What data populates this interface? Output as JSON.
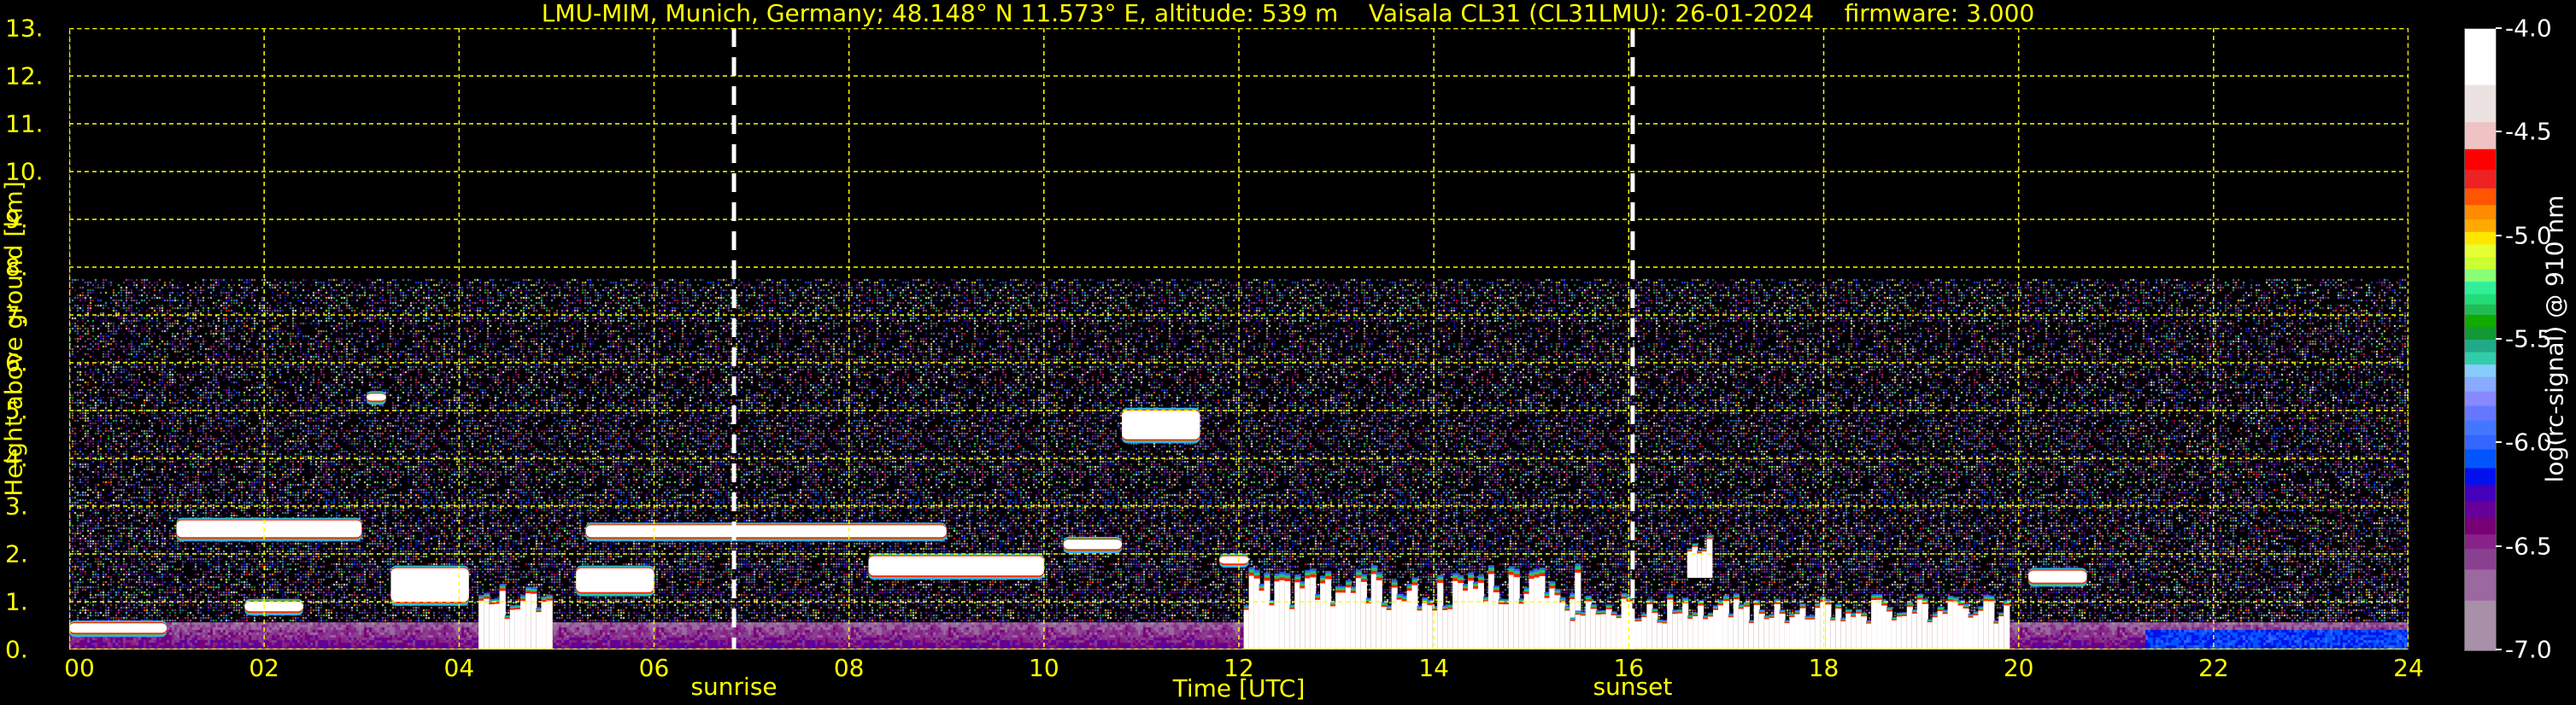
{
  "chart_data": {
    "type": "heatmap",
    "title": "LMU-MIM, Munich, Germany; 48.148° N 11.573° E, altitude: 539 m    Vaisala CL31 (CL31LMU): 26-01-2024    firmware: 3.000",
    "xlabel": "Time [UTC]",
    "ylabel": "Height above ground [km]",
    "xlim": [
      0,
      24
    ],
    "ylim": [
      0,
      13
    ],
    "x_ticks": [
      0,
      2,
      4,
      6,
      8,
      10,
      12,
      14,
      16,
      18,
      20,
      22,
      24
    ],
    "x_tick_labels": [
      "00",
      "02",
      "04",
      "06",
      "08",
      "10",
      "12",
      "14",
      "16",
      "18",
      "20",
      "22",
      "24"
    ],
    "y_ticks": [
      0,
      1,
      2,
      3,
      4,
      5,
      6,
      7,
      8,
      9,
      10,
      11,
      12,
      13
    ],
    "y_tick_labels": [
      "0.",
      "1.",
      "2.",
      "3.",
      "4.",
      "5.",
      "6.",
      "7.",
      "8.",
      "9.",
      "10.",
      "11.",
      "12.",
      "13."
    ],
    "grid": true,
    "events": [
      {
        "label": "sunrise",
        "time": 6.82
      },
      {
        "label": "sunset",
        "time": 16.04
      }
    ],
    "signal_max_height_km": 7.75,
    "colorbar": {
      "label": "log(rc-signal) @ 910 nm",
      "range": [
        -7.0,
        -4.0
      ],
      "tick_values": [
        -4.0,
        -4.5,
        -5.0,
        -5.5,
        -6.0,
        -6.5,
        -7.0
      ],
      "tick_labels": [
        "-4.0",
        "-4.5",
        "-5.0",
        "-5.5",
        "-6.0",
        "-6.5",
        "-7.0"
      ],
      "levels": [
        {
          "from": -4.27,
          "color": "#ffffff"
        },
        {
          "from": -4.45,
          "color": "#ece2e2"
        },
        {
          "from": -4.58,
          "color": "#efc3c3"
        },
        {
          "from": -4.68,
          "color": "#ff0000"
        },
        {
          "from": -4.77,
          "color": "#ee2222"
        },
        {
          "from": -4.85,
          "color": "#ff5500"
        },
        {
          "from": -4.92,
          "color": "#ff8c00"
        },
        {
          "from": -4.98,
          "color": "#ffaa00"
        },
        {
          "from": -5.04,
          "color": "#ffe600"
        },
        {
          "from": -5.1,
          "color": "#e6ff33"
        },
        {
          "from": -5.16,
          "color": "#ccff33"
        },
        {
          "from": -5.22,
          "color": "#88ff77"
        },
        {
          "from": -5.28,
          "color": "#33ee99"
        },
        {
          "from": -5.33,
          "color": "#22dd77"
        },
        {
          "from": -5.38,
          "color": "#22bb55"
        },
        {
          "from": -5.44,
          "color": "#11aa00"
        },
        {
          "from": -5.5,
          "color": "#119933"
        },
        {
          "from": -5.56,
          "color": "#22aa88"
        },
        {
          "from": -5.62,
          "color": "#33ccaa"
        },
        {
          "from": -5.68,
          "color": "#88ccff"
        },
        {
          "from": -5.75,
          "color": "#88aaff"
        },
        {
          "from": -5.82,
          "color": "#8888ff"
        },
        {
          "from": -5.89,
          "color": "#6677ff"
        },
        {
          "from": -5.96,
          "color": "#4477ff"
        },
        {
          "from": -6.03,
          "color": "#3366ff"
        },
        {
          "from": -6.12,
          "color": "#0055ff"
        },
        {
          "from": -6.2,
          "color": "#0011ee"
        },
        {
          "from": -6.28,
          "color": "#4400bb"
        },
        {
          "from": -6.36,
          "color": "#660099"
        },
        {
          "from": -6.44,
          "color": "#770077"
        },
        {
          "from": -6.51,
          "color": "#882288"
        },
        {
          "from": -6.61,
          "color": "#8a4090"
        },
        {
          "from": -6.76,
          "color": "#9c68a0"
        },
        {
          "from": -7.0,
          "color": "#a890a8"
        }
      ]
    },
    "features": [
      {
        "name": "low-aerosol-top-night",
        "t0": 0.0,
        "t1": 1.0,
        "h0": 0.35,
        "h1": 0.55,
        "kind": "layer"
      },
      {
        "name": "cloud-2-5km-night",
        "t0": 1.1,
        "t1": 3.0,
        "h0": 2.35,
        "h1": 2.7,
        "kind": "layer"
      },
      {
        "name": "cloud-0-9km",
        "t0": 1.8,
        "t1": 2.4,
        "h0": 0.8,
        "h1": 1.0,
        "kind": "layer"
      },
      {
        "name": "cloud-5-3km",
        "t0": 3.05,
        "t1": 3.25,
        "h0": 5.25,
        "h1": 5.35,
        "kind": "layer"
      },
      {
        "name": "broken-cloud-1-5km",
        "t0": 3.3,
        "t1": 4.1,
        "h0": 1.0,
        "h1": 1.7,
        "kind": "layer"
      },
      {
        "name": "precip-column-04h",
        "t0": 4.2,
        "t1": 4.95,
        "h0": 0.0,
        "h1": 1.4,
        "kind": "column"
      },
      {
        "name": "cloud-1-5km-05h",
        "t0": 5.2,
        "t1": 6.0,
        "h0": 1.2,
        "h1": 1.7,
        "kind": "layer"
      },
      {
        "name": "cloud-2-5km-morning",
        "t0": 5.3,
        "t1": 9.0,
        "h0": 2.35,
        "h1": 2.6,
        "kind": "layer"
      },
      {
        "name": "cloud-1-7km-09h",
        "t0": 8.2,
        "t1": 10.0,
        "h0": 1.55,
        "h1": 1.95,
        "kind": "layer"
      },
      {
        "name": "cloud-2-2km-10h",
        "t0": 10.2,
        "t1": 10.8,
        "h0": 2.1,
        "h1": 2.3,
        "kind": "layer"
      },
      {
        "name": "midlevel-cloud-4-8km",
        "t0": 10.8,
        "t1": 11.6,
        "h0": 4.4,
        "h1": 5.0,
        "kind": "layer"
      },
      {
        "name": "cloud-1-9km-noon",
        "t0": 11.8,
        "t1": 12.1,
        "h0": 1.8,
        "h1": 1.95,
        "kind": "layer"
      },
      {
        "name": "precip-column-afternoon",
        "t0": 12.05,
        "t1": 15.5,
        "h0": 0.0,
        "h1": 1.8,
        "kind": "column"
      },
      {
        "name": "low-cloud-evening",
        "t0": 15.4,
        "t1": 19.9,
        "h0": 0.0,
        "h1": 1.2,
        "kind": "column"
      },
      {
        "name": "cloud-2-5km-17h",
        "t0": 16.6,
        "t1": 16.85,
        "h0": 1.5,
        "h1": 2.6,
        "kind": "column"
      },
      {
        "name": "cloud-1-5km-20h",
        "t0": 20.1,
        "t1": 20.7,
        "h0": 1.4,
        "h1": 1.65,
        "kind": "layer"
      }
    ]
  }
}
